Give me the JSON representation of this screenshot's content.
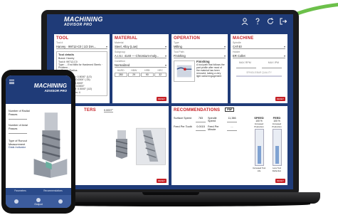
{
  "app": {
    "logo_line1": "MACHINING",
    "logo_line2": "ADVISOR PRO"
  },
  "header_icons": [
    "user-icon",
    "help-icon",
    "refresh-icon",
    "logout-icon"
  ],
  "colors": {
    "brand_blue": "#1f3b78",
    "accent_red": "#c62026",
    "accent_green": "#6cc04a"
  },
  "tool": {
    "title": "TOOL",
    "field_label": "Tool #",
    "field_value": "Harvey · 99712-C0 | 1/2 DIA...",
    "details_title": "Tool details",
    "details": [
      "Brand: Harvey",
      "Tool #: 99712-C0",
      "Type: ... End Mills for Hardened Steels · Problem...",
      "... Corner Radius",
      "Units: Inches",
      "Cutter Diameter: 0.5000\" (1/2)",
      "Corner Radius: 0.0300\" (.03)",
      "Length of Cut: 0.0000\"",
      "Overall Length: 3.0000\"",
      "Shank Diameter: 0.5000\" (1/2)",
      "Number of Flutes: 4"
    ]
  },
  "material": {
    "title": "MATERIAL",
    "field1_label": "Material",
    "field1_value": "Steel, Alloy (Low)",
    "field2_label": "Subgroup",
    "field2_value": "A.I.S.I. 4140 — Chromium-moly...",
    "field3_label": "Condition",
    "field3_value": "Normalized",
    "dim_headers": [
      "HARD",
      "HBW",
      "HRB",
      "HRC"
    ],
    "dim_values": [
      "280",
      "29",
      "90",
      "32"
    ],
    "reset": "RESET"
  },
  "operation": {
    "title": "OPERATION",
    "field1_label": "Type",
    "field1_value": "Milling",
    "field2_label": "Tool Path",
    "field2_value": "Finishing",
    "sub_title": "Finishing",
    "sub_text": "A tool path that follows the part profile after most of the material has been removed, taking a very light radial engagement"
  },
  "machine": {
    "title": "MACHINE",
    "field1_label": "Spindle",
    "field1_value": "CAT40",
    "field2_label": "Holder",
    "field2_value": "ER Collet",
    "max_rpm_label": "MAX RPM",
    "max_ipm_label": "MAX IPM",
    "spindle_label": "SPINDLE/BAR QUALITY",
    "reset": "RESET"
  },
  "parameters": {
    "title": "TERS",
    "value": "0.0007\"",
    "reset": "RESET"
  },
  "recommendations": {
    "title": "RECOMMENDATIONS",
    "pdf": "PDF",
    "surface_speed_label": "Surface Speed",
    "surface_speed_value": "783",
    "spindle_speed_label": "Spindle Speed",
    "spindle_speed_value": "11,386",
    "feed_per_tooth_label": "Feed Per Tooth",
    "feed_per_tooth_value": "0.0015",
    "feed_per_minute_label": "Feed Per Minute",
    "feed_per_minute_value": "...",
    "speed_label": "SPEED",
    "speed_pct": "100 %",
    "feed_label": "FEED",
    "feed_pct": "100 %",
    "speed_level": 0.5,
    "feed_level": 0.5,
    "gauge1_top": "Increased Production",
    "gauge1_bottom": "Increased Tool Life",
    "gauge2_top": "Increased Production",
    "gauge2_bottom": "Less Tool Deflection",
    "reset": "RESET"
  },
  "phone": {
    "logo_line1": "MACHINING",
    "logo_line2": "ADVISOR PRO",
    "label1": "Number of Radial Passes",
    "label2": "Number of Axial Passes",
    "label3": "Type of Runout Measurement",
    "label3_value": "Dials Indicator",
    "foot_label1": "Parameters",
    "foot_label2": "Recommendations",
    "tab": "Output"
  }
}
